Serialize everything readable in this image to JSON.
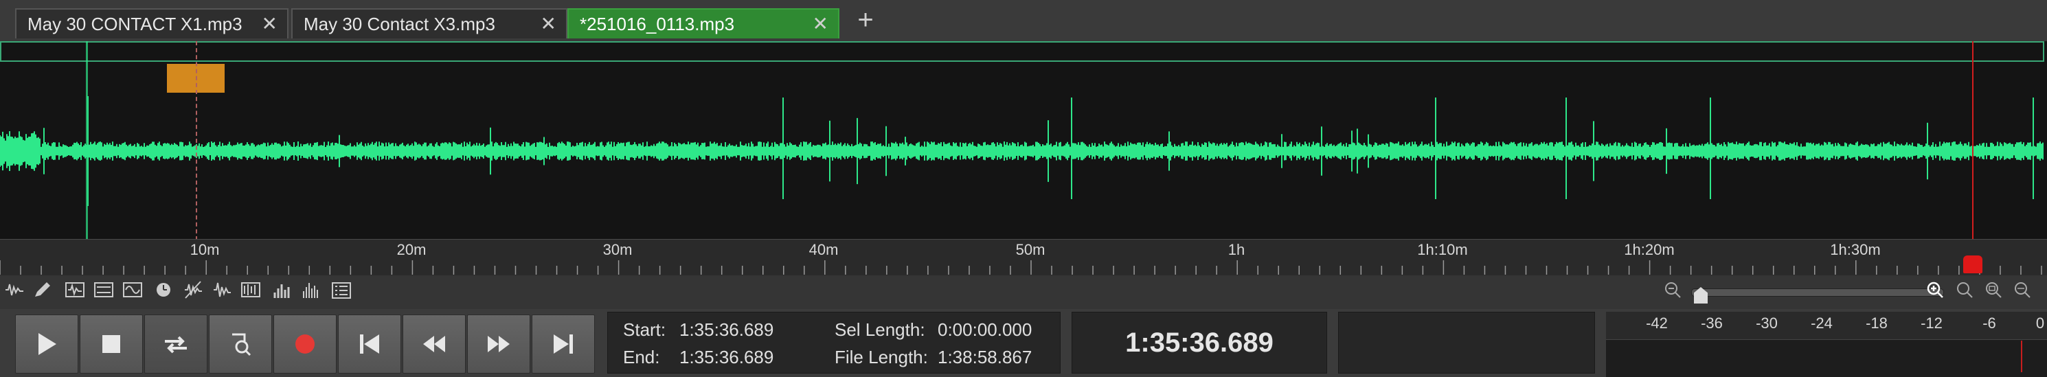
{
  "tabs": [
    {
      "label": "May 30 CONTACT X1.mp3",
      "active": false
    },
    {
      "label": "May 30 Contact X3.mp3",
      "active": false
    },
    {
      "label": "*251016_0113.mp3",
      "active": true
    }
  ],
  "tab_close_glyph": "✕",
  "add_tab_glyph": "+",
  "timeline": {
    "labels": [
      "10m",
      "20m",
      "30m",
      "40m",
      "50m",
      "1h",
      "1h:10m",
      "1h:20m",
      "1h:30m"
    ]
  },
  "selection": {
    "start_label": "Start:",
    "start_value": "1:35:36.689",
    "end_label": "End:",
    "end_value": "1:35:36.689",
    "sel_length_label": "Sel Length:",
    "sel_length_value": "0:00:00.000",
    "file_length_label": "File Length:",
    "file_length_value": "1:38:58.867"
  },
  "current_time": "1:35:36.689",
  "meter": {
    "labels": [
      "-42",
      "-36",
      "-30",
      "-24",
      "-18",
      "-12",
      "-6",
      "0"
    ]
  },
  "colors": {
    "waveform": "#2ee88a",
    "active_tab": "#2f8a32",
    "playhead": "#d21e1e",
    "marker": "#d4891e",
    "record": "#e53935"
  }
}
